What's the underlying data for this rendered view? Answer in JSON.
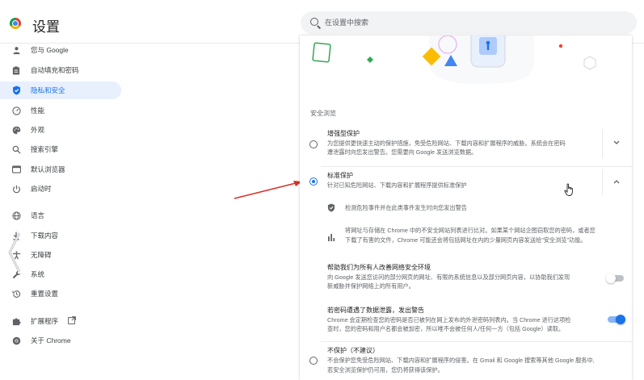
{
  "app": {
    "title": "设置"
  },
  "search": {
    "placeholder": "在设置中搜索"
  },
  "sidebar": {
    "items": [
      {
        "label": "您与 Google",
        "icon": "person-icon"
      },
      {
        "label": "自动填充和密码",
        "icon": "clipboard-icon"
      },
      {
        "label": "隐私和安全",
        "icon": "shield-icon",
        "active": true
      },
      {
        "label": "性能",
        "icon": "speedometer-icon"
      },
      {
        "label": "外观",
        "icon": "palette-icon"
      },
      {
        "label": "搜索引擎",
        "icon": "search-icon"
      },
      {
        "label": "默认浏览器",
        "icon": "browser-icon"
      },
      {
        "label": "启动时",
        "icon": "power-icon"
      },
      {
        "label": "语言",
        "icon": "globe-icon"
      },
      {
        "label": "下载内容",
        "icon": "download-icon"
      },
      {
        "label": "无障碍",
        "icon": "accessibility-icon"
      },
      {
        "label": "系统",
        "icon": "wrench-icon"
      },
      {
        "label": "重置设置",
        "icon": "history-icon"
      },
      {
        "label": "扩展程序",
        "icon": "puzzle-icon"
      },
      {
        "label": "关于 Chrome",
        "icon": "chrome-icon"
      }
    ]
  },
  "main": {
    "section_title": "安全浏览",
    "options": {
      "enhanced": {
        "title": "增强型保护",
        "desc1": "为您提供更快速主动的保护措施，免受危险网站、下载内容和扩展程序的威胁。系统会在密码",
        "desc2": "遭泄露时向您发出警告。您需要向 Google 发送浏览数据。",
        "checked": false
      },
      "standard": {
        "title": "标准保护",
        "desc": "针对已知危险网站、下载内容和扩展程序提供标准保护",
        "checked": true
      },
      "none": {
        "title": "不保护（不建议）",
        "desc1": "不会保护您免受危险网站、下载内容和扩展程序的侵害。在 Gmail 和 Google 搜索等其他 Google 服务中,",
        "desc2": "若安全浏览保护仍可用，您仍将获得该保护。",
        "checked": false
      }
    },
    "details": [
      {
        "text": "检测危险事件并在此类事件发生时向您发出警告",
        "icon": "shield-check-icon"
      },
      {
        "text1": "将网址与存储在 Chrome 中的不安全网站列表进行比对。如果某个网站企图窃取您的密码，或者您",
        "text2": "下载了有害的文件，Chrome 可能还会将包括网址在内的少量网页内容发送给\"安全浏览\"功能。",
        "icon": "bar-chart-icon"
      }
    ],
    "help": {
      "title": "帮助我们为所有人改善网络安全环境",
      "desc1": "向 Google 发送您访问的部分网页的网址、有限的系统信息以及部分网页内容，以协助我们发现",
      "desc2": "新威胁并保护网络上的所有用户。",
      "enabled": false
    },
    "leak": {
      "title": "若密码遭遇了数据泄露，发出警告",
      "desc1": "Chrome 会定期检查您的密码是否已被列在网上发布的外泄密码列表内。当 Chrome 进行这项检",
      "desc2": "查时，您的密码和用户名都会被加密，所以唯不会被任何人/任何一方（包括 Google）读取。",
      "enabled": true
    }
  },
  "colors": {
    "accent": "#1a73e8",
    "active_bg": "#e8f0fe",
    "arrow": "#d93025"
  }
}
